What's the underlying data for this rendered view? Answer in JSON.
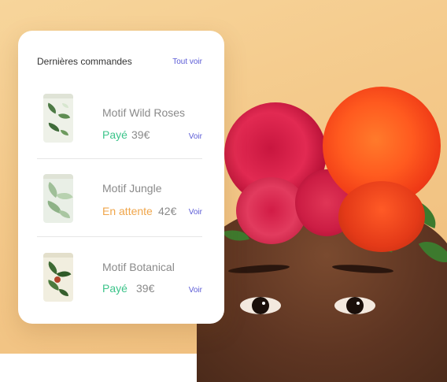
{
  "card": {
    "title": "Dernières commandes",
    "view_all": "Tout voir"
  },
  "orders": [
    {
      "name": "Motif Wild Roses",
      "status": "Payé",
      "status_color": "#3cc48a",
      "price": "39€",
      "view": "Voir"
    },
    {
      "name": "Motif Jungle",
      "status": "En attente",
      "status_color": "#f0a64b",
      "price": "42€",
      "view": "Voir"
    },
    {
      "name": "Motif Botanical",
      "status": "Payé",
      "status_color": "#3cc48a",
      "price": "39€",
      "view": "Voir"
    }
  ],
  "colors": {
    "accent": "#5b5bd6",
    "paid": "#3cc48a",
    "pending": "#f0a64b"
  }
}
